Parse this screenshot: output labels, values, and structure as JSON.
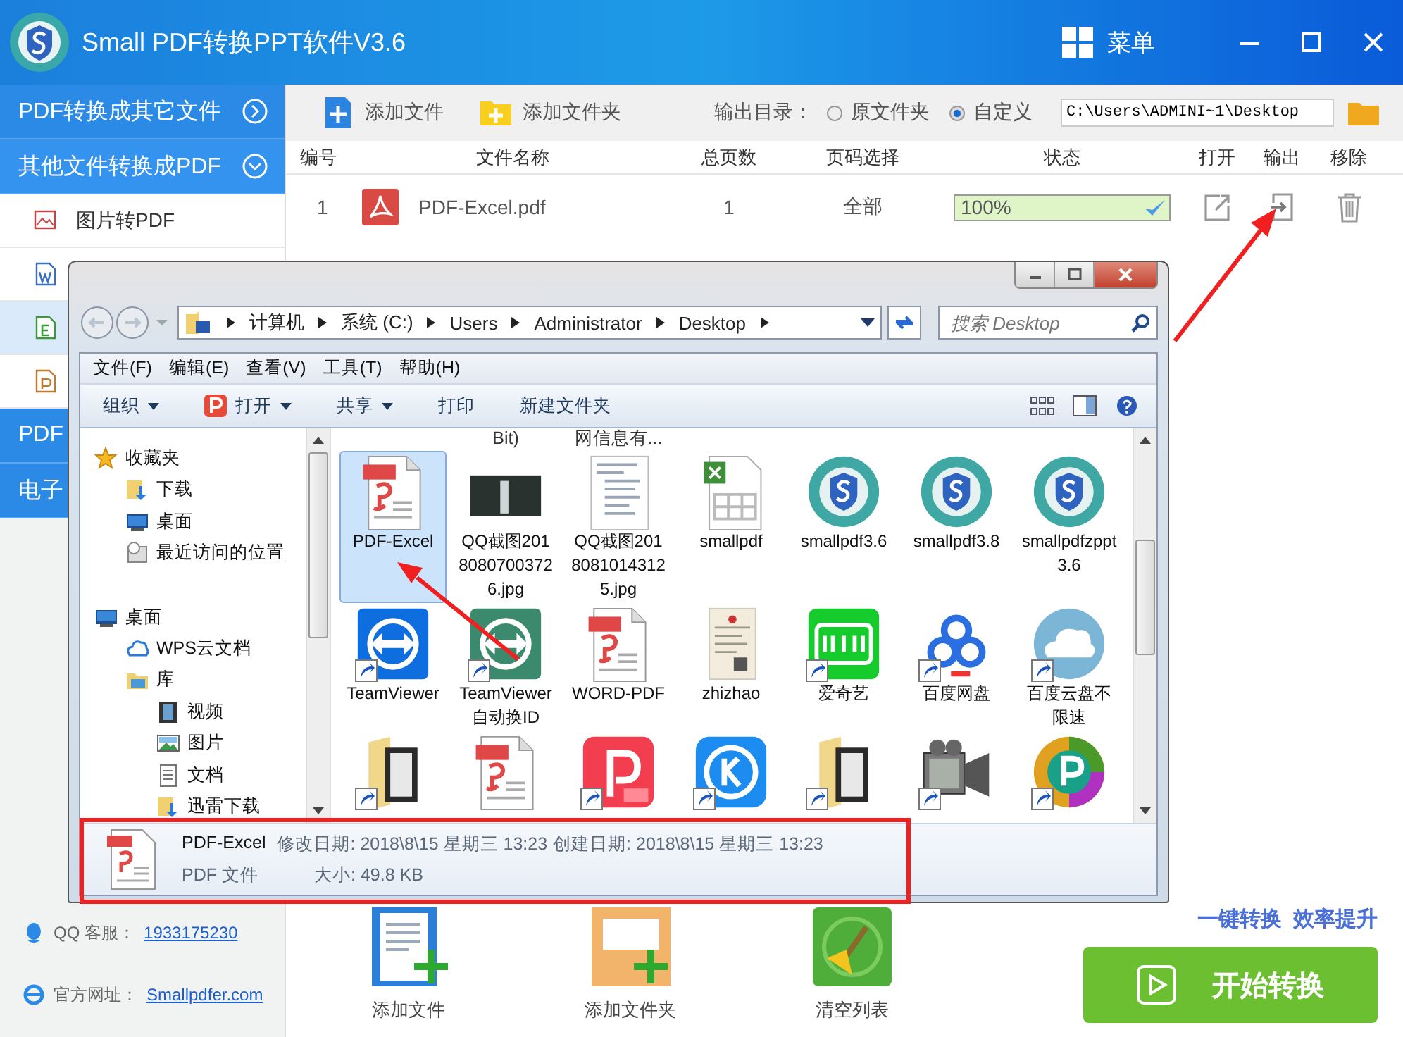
{
  "app": {
    "title": "Small PDF转换PPT软件V3.6",
    "menu_label": "菜单"
  },
  "sidebar": {
    "sections": [
      {
        "label": "PDF转换成其它文件",
        "expanded": false
      },
      {
        "label": "其他文件转换成PDF",
        "expanded": true,
        "items": [
          {
            "label": "图片转PDF",
            "kind": "image",
            "selected": false
          },
          {
            "kind": "word",
            "selected": false
          },
          {
            "kind": "excel",
            "selected": true
          },
          {
            "kind": "ppt",
            "selected": false
          }
        ]
      },
      {
        "label": "PDF"
      },
      {
        "label": "电子"
      }
    ],
    "contacts": [
      {
        "kind": "qq",
        "label": "QQ 客服：",
        "link": "1933175230"
      },
      {
        "kind": "web",
        "label": "官方网址：",
        "link": "Smallpdfer.com"
      }
    ]
  },
  "toolbar": {
    "add_file": "添加文件",
    "add_folder": "添加文件夹",
    "output_label": "输出目录：",
    "options": [
      {
        "label": "原文件夹",
        "selected": false
      },
      {
        "label": "自定义",
        "selected": true
      }
    ],
    "path": "C:\\Users\\ADMINI~1\\Desktop"
  },
  "table": {
    "columns": [
      "编号",
      "文件名称",
      "总页数",
      "页码选择",
      "状态",
      "打开",
      "输出",
      "移除"
    ],
    "rows": [
      {
        "index": "1",
        "name": "PDF-Excel.pdf",
        "pages": "1",
        "range": "全部",
        "status": "100%",
        "level": 1,
        "done": true
      }
    ]
  },
  "bottom": {
    "actions": [
      {
        "kind": "add-file",
        "label": "添加文件"
      },
      {
        "kind": "add-folder",
        "label": "添加文件夹"
      },
      {
        "kind": "clear",
        "label": "清空列表"
      }
    ],
    "slogans": [
      "一键转换",
      "效率提升"
    ],
    "start_button": "开始转换"
  },
  "dialog": {
    "breadcrumb": [
      "计算机",
      "系统 (C:)",
      "Users",
      "Administrator",
      "Desktop"
    ],
    "search_placeholder": "搜索 Desktop",
    "menu": [
      "文件(F)",
      "编辑(E)",
      "查看(V)",
      "工具(T)",
      "帮助(H)"
    ],
    "toolbar": [
      {
        "label": "组织",
        "kind": "plain",
        "dropdown": true
      },
      {
        "label": "打开",
        "kind": "open",
        "dropdown": true
      },
      {
        "label": "共享",
        "kind": "plain",
        "dropdown": true
      },
      {
        "label": "打印",
        "kind": "plain",
        "dropdown": false
      },
      {
        "label": "新建文件夹",
        "kind": "plain",
        "dropdown": false
      }
    ],
    "nav": [
      {
        "label": "收藏夹",
        "kind": "star",
        "children": [
          {
            "label": "下载",
            "kind": "download"
          },
          {
            "label": "桌面",
            "kind": "desktop"
          },
          {
            "label": "最近访问的位置",
            "kind": "recent"
          }
        ]
      },
      {
        "label": "桌面",
        "kind": "desktop",
        "children": [
          {
            "label": "WPS云文档",
            "kind": "cloud"
          },
          {
            "label": "库",
            "kind": "library",
            "children": [
              {
                "label": "视频",
                "kind": "video"
              },
              {
                "label": "图片",
                "kind": "picture"
              },
              {
                "label": "文档",
                "kind": "document"
              },
              {
                "label": "迅雷下载",
                "kind": "download"
              }
            ]
          }
        ]
      }
    ],
    "partial_row": [
      {
        "kind": "blank"
      },
      {
        "kind": "label",
        "label": "Bit)"
      },
      {
        "kind": "label",
        "label": "网信息有..."
      }
    ],
    "files": [
      {
        "label": "PDF-Excel",
        "kind": "pdf",
        "shortcut": false,
        "selected": true
      },
      {
        "label": "QQ截图20180807003726.jpg",
        "kind": "photo",
        "shortcut": false,
        "selected": false
      },
      {
        "label": "QQ截图20180810143125.jpg",
        "kind": "screenshot",
        "shortcut": false,
        "selected": false
      },
      {
        "label": "smallpdf",
        "kind": "excel",
        "shortcut": false,
        "selected": false
      },
      {
        "label": "smallpdf3.6",
        "kind": "app-s",
        "shortcut": false,
        "selected": false
      },
      {
        "label": "smallpdf3.8",
        "kind": "app-s",
        "shortcut": false,
        "selected": false
      },
      {
        "label": "smallpdfzppt3.6",
        "kind": "app-s",
        "shortcut": false,
        "selected": false
      },
      {
        "label": "TeamViewer",
        "kind": "teamviewer",
        "shortcut": true,
        "selected": false
      },
      {
        "label": "TeamViewer自动换ID",
        "kind": "teamviewer-green",
        "shortcut": true,
        "selected": false
      },
      {
        "label": "WORD-PDF",
        "kind": "pdf",
        "shortcut": false,
        "selected": false
      },
      {
        "label": "zhizhao",
        "kind": "certificate",
        "shortcut": false,
        "selected": false
      },
      {
        "label": "爱奇艺",
        "kind": "iqiyi",
        "shortcut": true,
        "selected": false
      },
      {
        "label": "百度网盘",
        "kind": "baidu",
        "shortcut": true,
        "selected": false
      },
      {
        "label": "百度云盘不限速",
        "kind": "cloud",
        "shortcut": true,
        "selected": false
      },
      {
        "kind": "folder",
        "shortcut": true,
        "selected": false
      },
      {
        "kind": "pdf",
        "shortcut": false,
        "selected": false
      },
      {
        "kind": "pdf-app",
        "shortcut": true,
        "selected": false
      },
      {
        "kind": "k-app",
        "shortcut": true,
        "selected": false
      },
      {
        "kind": "folder",
        "shortcut": true,
        "selected": false
      },
      {
        "kind": "camera",
        "shortcut": true,
        "selected": false
      },
      {
        "kind": "p-app",
        "shortcut": true,
        "selected": false
      }
    ],
    "status": {
      "name": "PDF-Excel",
      "type": "PDF 文件",
      "modified": {
        "label": "修改日期:",
        "value": "2018\\8\\15 星期三 13:23"
      },
      "created": {
        "label": "创建日期:",
        "value": "2018\\8\\15 星期三 13:23"
      },
      "size": {
        "label": "大小:",
        "value": "49.8 KB"
      }
    }
  }
}
